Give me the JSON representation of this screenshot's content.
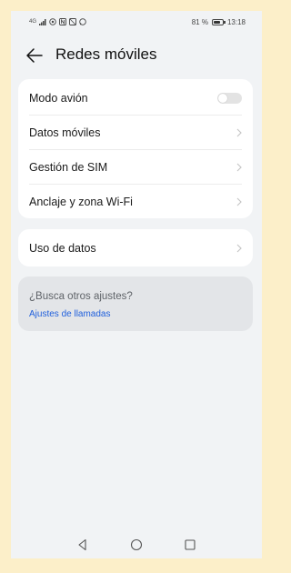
{
  "status_bar": {
    "left_text": "4G",
    "battery_text": "81 %",
    "battery_level": 0.81,
    "time": "13:18"
  },
  "header": {
    "title": "Redes móviles",
    "back_icon": "arrow-left-icon"
  },
  "settings_card": {
    "items": [
      {
        "label": "Modo avión",
        "control": "toggle",
        "toggle_on": false
      },
      {
        "label": "Datos móviles",
        "control": "chevron"
      },
      {
        "label": "Gestión de SIM",
        "control": "chevron"
      },
      {
        "label": "Anclaje y zona Wi-Fi",
        "control": "chevron"
      }
    ]
  },
  "data_card": {
    "items": [
      {
        "label": "Uso de datos",
        "control": "chevron"
      }
    ]
  },
  "suggestion": {
    "question": "¿Busca otros ajustes?",
    "link": "Ajustes de llamadas"
  },
  "nav": {
    "icons": [
      "back-triangle-icon",
      "home-circle-icon",
      "recents-square-icon"
    ]
  },
  "colors": {
    "background": "#f1f3f5",
    "card": "#ffffff",
    "link": "#1f5fdc",
    "frame": "#fcefc9"
  }
}
